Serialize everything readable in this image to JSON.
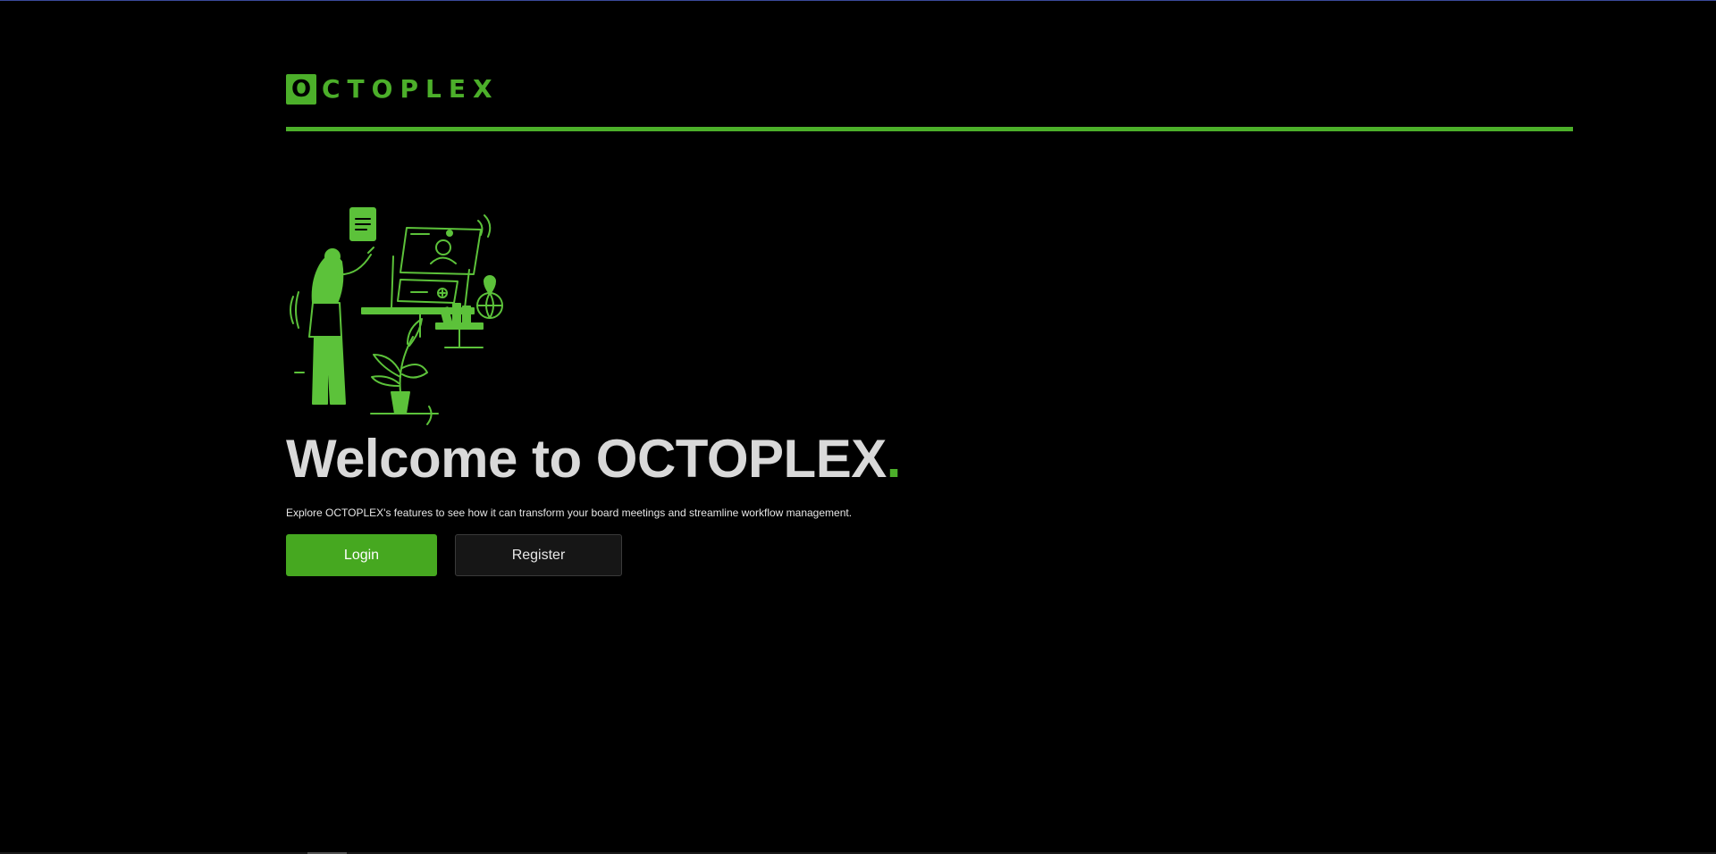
{
  "brand": {
    "logo_letter": "O",
    "logo_rest": "CTOPLEX",
    "accent_color": "#4caf2a"
  },
  "hero": {
    "illustration_icon": "presentation-illustration",
    "title": "Welcome to OCTOPLEX",
    "title_dot": ".",
    "subtitle": "Explore OCTOPLEX's features to see how it can transform your board meetings and streamline workflow management."
  },
  "actions": {
    "login_label": "Login",
    "register_label": "Register"
  }
}
